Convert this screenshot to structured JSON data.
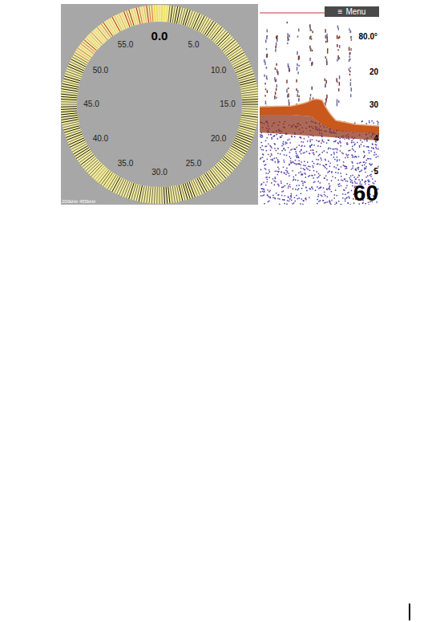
{
  "sector_view": {
    "heading": "0.0",
    "labels": [
      "5.0",
      "10.0",
      "15.0",
      "20.0",
      "25.0",
      "30.0",
      "35.0",
      "40.0",
      "45.0",
      "50.0",
      "55.0"
    ],
    "frequency": "200kHz 455kHz"
  },
  "sonar_view": {
    "menu": {
      "icon": "≡",
      "label": "Menu"
    },
    "angle": "80.0°",
    "depth_scale": [
      "20",
      "30",
      "4",
      "5"
    ],
    "range": "60"
  }
}
